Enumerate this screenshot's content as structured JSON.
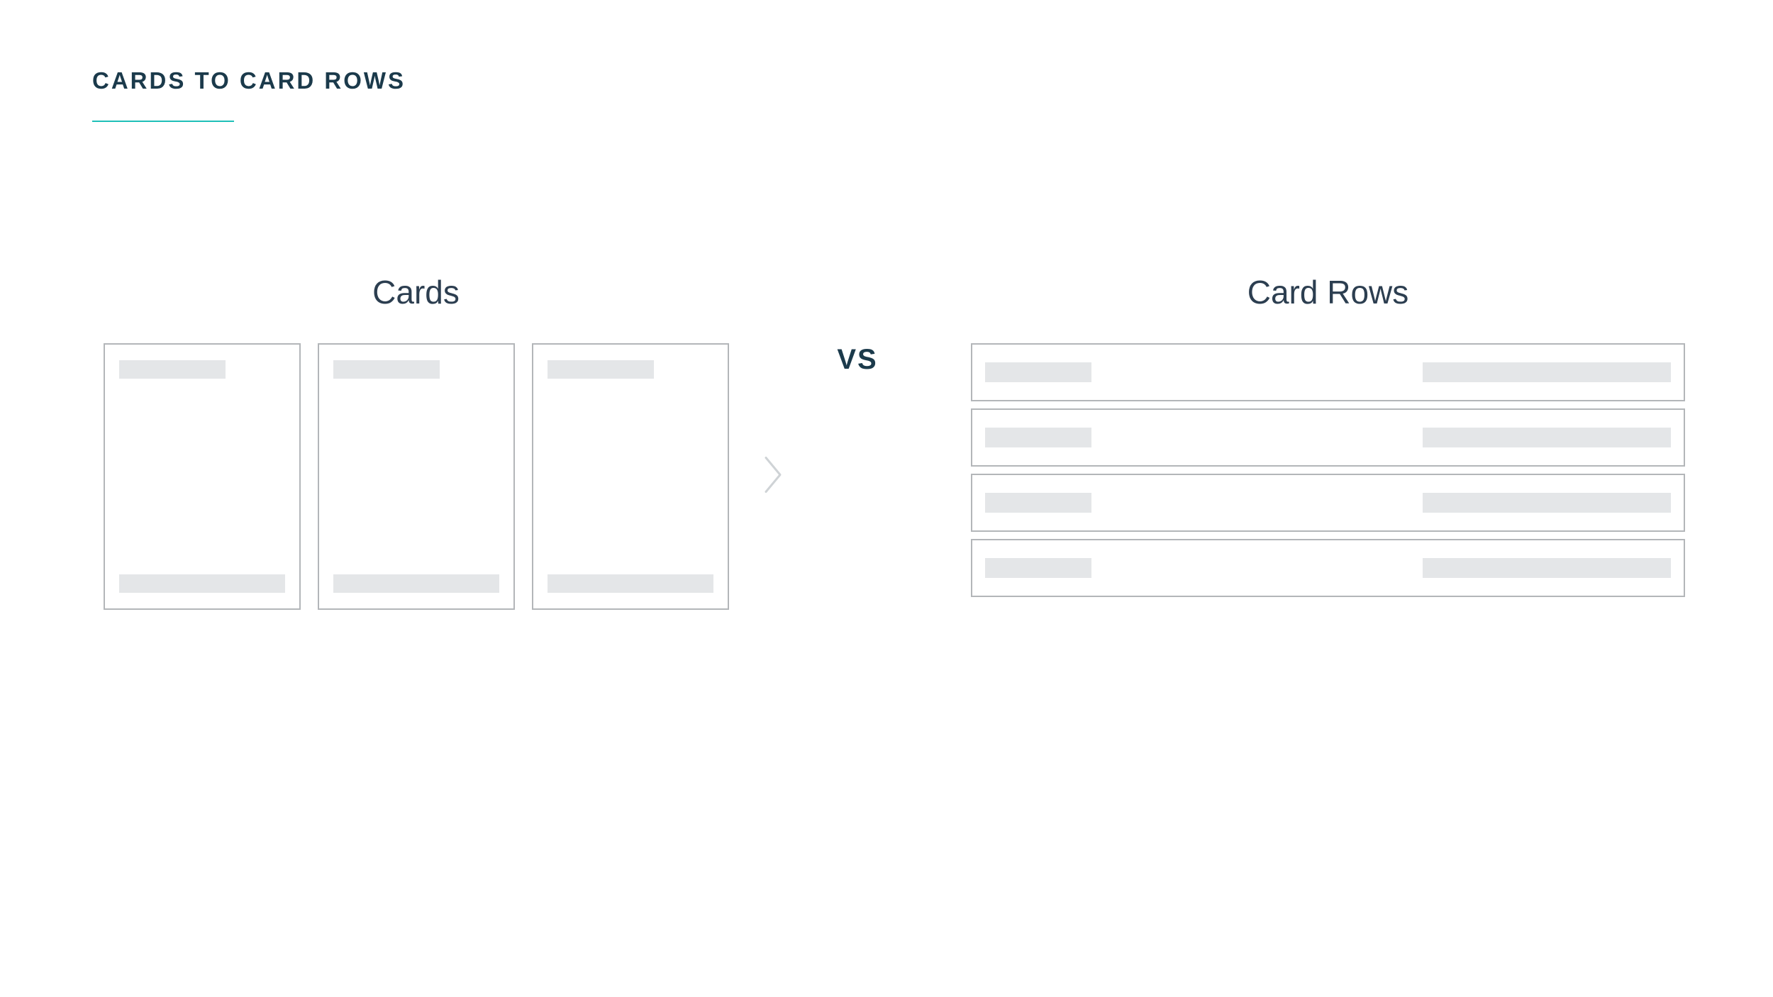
{
  "title": "CARDS TO CARD ROWS",
  "left_label": "Cards",
  "right_label": "Card Rows",
  "vs_label": "VS",
  "cards_count": 3,
  "rows_count": 4,
  "colors": {
    "heading": "#1b3a4b",
    "accent": "#1fbfb8",
    "border": "#b3b6b9",
    "placeholder": "#e4e6e8",
    "label": "#2c3e50"
  }
}
